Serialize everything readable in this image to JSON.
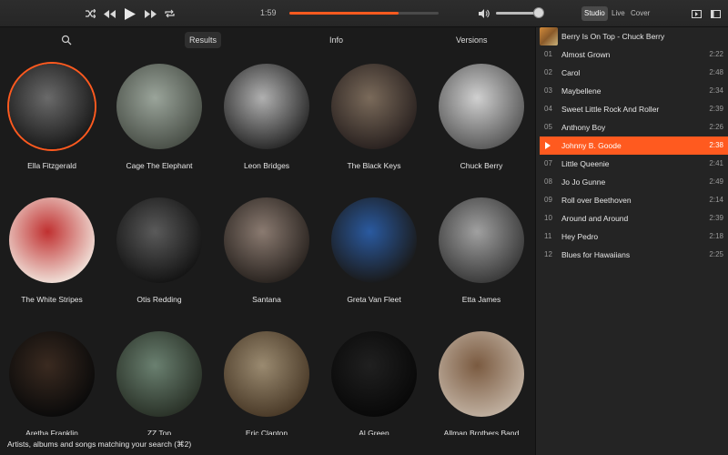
{
  "colors": {
    "accent": "#ff5a1f",
    "background": "#1b1b1b",
    "panel": "#242424"
  },
  "player": {
    "elapsed": "1:59",
    "progress_percent": 73,
    "volume_percent": 84,
    "mode_tabs": [
      "Studio",
      "Live",
      "Cover"
    ],
    "active_mode": "Studio",
    "icons": [
      "shuffle-icon",
      "rewind-icon",
      "play-icon",
      "fast-forward-icon",
      "repeat-icon",
      "volume-icon",
      "sidebar-toggle-icon",
      "fullscreen-icon"
    ]
  },
  "left_tabs": {
    "results": "Results",
    "info": "Info",
    "versions": "Versions"
  },
  "artists": [
    {
      "name": "Ella Fitzgerald",
      "selected": true
    },
    {
      "name": "Cage The Elephant"
    },
    {
      "name": "Leon Bridges"
    },
    {
      "name": "The Black Keys"
    },
    {
      "name": "Chuck Berry"
    },
    {
      "name": "The White Stripes"
    },
    {
      "name": "Otis Redding"
    },
    {
      "name": "Santana"
    },
    {
      "name": "Greta Van Fleet"
    },
    {
      "name": "Etta James"
    },
    {
      "name": "Aretha Franklin"
    },
    {
      "name": "ZZ Top"
    },
    {
      "name": "Eric Clapton"
    },
    {
      "name": "Al Green"
    },
    {
      "name": "Allman Brothers Band"
    }
  ],
  "status": {
    "text": "Artists, albums and songs matching your search (⌘2)"
  },
  "now_playing": {
    "title": "Berry Is On Top - Chuck Berry"
  },
  "tracks": [
    {
      "num": "01",
      "title": "Almost Grown",
      "duration": "2:22"
    },
    {
      "num": "02",
      "title": "Carol",
      "duration": "2:48"
    },
    {
      "num": "03",
      "title": "Maybellene",
      "duration": "2:34"
    },
    {
      "num": "04",
      "title": "Sweet Little Rock And Roller",
      "duration": "2:39"
    },
    {
      "num": "05",
      "title": "Anthony Boy",
      "duration": "2:26"
    },
    {
      "num": "06",
      "title": "Johnny B. Goode",
      "duration": "2:38",
      "playing": true
    },
    {
      "num": "07",
      "title": "Little Queenie",
      "duration": "2:41"
    },
    {
      "num": "08",
      "title": "Jo Jo Gunne",
      "duration": "2:49"
    },
    {
      "num": "09",
      "title": "Roll over Beethoven",
      "duration": "2:14"
    },
    {
      "num": "10",
      "title": "Around and Around",
      "duration": "2:39"
    },
    {
      "num": "11",
      "title": "Hey Pedro",
      "duration": "2:18"
    },
    {
      "num": "12",
      "title": "Blues for Hawaiians",
      "duration": "2:25"
    }
  ]
}
